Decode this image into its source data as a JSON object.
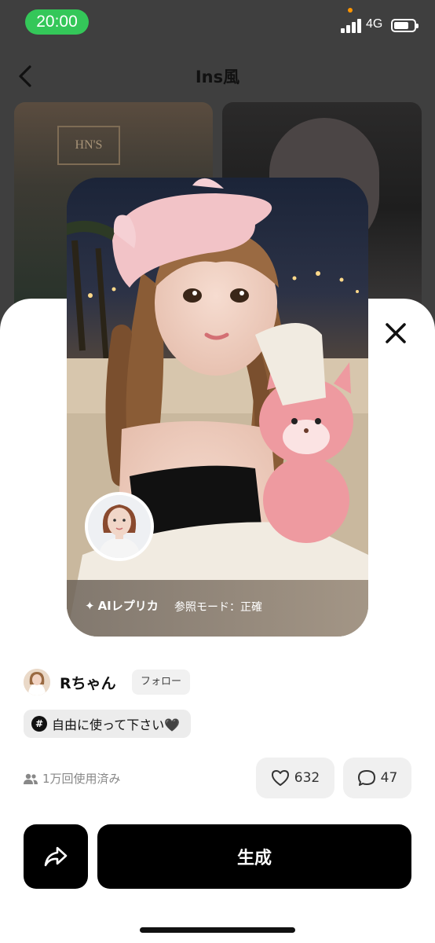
{
  "status_bar": {
    "time": "20:00",
    "network": "4G"
  },
  "header": {
    "title": "Ins風"
  },
  "background_tiles": {
    "sign_text": "HN'S"
  },
  "preview": {
    "ai_label": "AIレプリカ",
    "mode_label": "参照モード：正確"
  },
  "author": {
    "name": "Rちゃん",
    "follow_label": "フォロー"
  },
  "tag": {
    "hash": "#",
    "text": "自由に使って下さい🖤"
  },
  "stats": {
    "usage": "1万回使用済み",
    "likes": "632",
    "comments": "47"
  },
  "actions": {
    "generate_label": "生成"
  },
  "icons": [
    "chevron-left-icon",
    "close-icon",
    "sparkle-icon",
    "users-icon",
    "heart-icon",
    "comment-icon",
    "share-icon"
  ]
}
